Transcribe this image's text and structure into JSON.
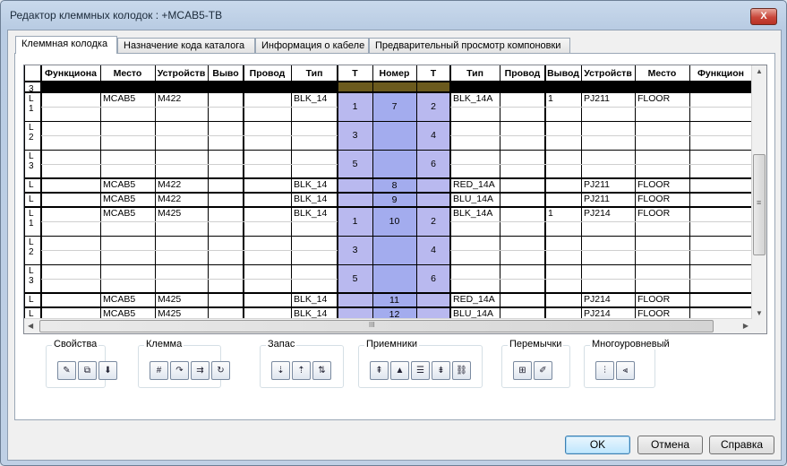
{
  "window": {
    "title": "Редактор клеммных колодок : +MCAB5-TB",
    "close_glyph": "X"
  },
  "tabs": [
    {
      "label": "Клеммная колодка",
      "active": true
    },
    {
      "label": "Назначение кода каталога",
      "active": false
    },
    {
      "label": "Информация о кабеле",
      "active": false
    },
    {
      "label": "Предварительный просмотр компоновки",
      "active": false
    }
  ],
  "grid": {
    "headers": [
      "",
      "Функциона",
      "Место",
      "Устройств",
      "Выво",
      "Провод",
      "Тип",
      "T",
      "Номер",
      "T",
      "Тип",
      "Провод",
      "Вывод",
      "Устройств",
      "Место",
      "Функцион"
    ],
    "rows": [
      {
        "id": "3",
        "cells": [
          "",
          "",
          "",
          "",
          "",
          "",
          "",
          "",
          "",
          "",
          "",
          "",
          "",
          "",
          ""
        ]
      },
      {
        "id": "L 1",
        "cells": [
          "",
          "MCAB5",
          "M422",
          "",
          "",
          "BLK_14",
          "1",
          "7",
          "2",
          "BLK_14A",
          "",
          "1",
          "PJ211",
          "FLOOR",
          ""
        ]
      },
      {
        "id": "L 2",
        "cells": [
          "",
          "",
          "",
          "",
          "",
          "",
          "3",
          "",
          "4",
          "",
          "",
          "",
          "",
          "",
          ""
        ]
      },
      {
        "id": "L 3",
        "cells": [
          "",
          "",
          "",
          "",
          "",
          "",
          "5",
          "",
          "6",
          "",
          "",
          "",
          "",
          "",
          ""
        ]
      },
      {
        "id": "L",
        "cells": [
          "",
          "MCAB5",
          "M422",
          "",
          "",
          "BLK_14",
          "",
          "8",
          "",
          "RED_14A",
          "",
          "",
          "PJ211",
          "FLOOR",
          ""
        ]
      },
      {
        "id": "L",
        "cells": [
          "",
          "MCAB5",
          "M422",
          "",
          "",
          "BLK_14",
          "",
          "9",
          "",
          "BLU_14A",
          "",
          "",
          "PJ211",
          "FLOOR",
          ""
        ]
      },
      {
        "id": "L 1",
        "cells": [
          "",
          "MCAB5",
          "M425",
          "",
          "",
          "BLK_14",
          "1",
          "10",
          "2",
          "BLK_14A",
          "",
          "1",
          "PJ214",
          "FLOOR",
          ""
        ]
      },
      {
        "id": "L 2",
        "cells": [
          "",
          "",
          "",
          "",
          "",
          "",
          "3",
          "",
          "4",
          "",
          "",
          "",
          "",
          "",
          ""
        ]
      },
      {
        "id": "L 3",
        "cells": [
          "",
          "",
          "",
          "",
          "",
          "",
          "5",
          "",
          "6",
          "",
          "",
          "",
          "",
          "",
          ""
        ]
      },
      {
        "id": "L",
        "cells": [
          "",
          "MCAB5",
          "M425",
          "",
          "",
          "BLK_14",
          "",
          "11",
          "",
          "RED_14A",
          "",
          "",
          "PJ214",
          "FLOOR",
          ""
        ]
      },
      {
        "id": "L",
        "cells": [
          "",
          "MCAB5",
          "M425",
          "",
          "",
          "BLK_14",
          "",
          "12",
          "",
          "BLU_14A",
          "",
          "",
          "PJ214",
          "FLOOR",
          ""
        ]
      }
    ],
    "colors": {
      "terminal_fill": "#b9b9ef",
      "terminal_number_fill": "#a3acee",
      "header_band": "#6b5a1d",
      "grid_line": "#000000"
    },
    "vscroll_glyph": "≡",
    "hscroll_glyph": "III"
  },
  "toolbar_groups": [
    {
      "label": "Свойства",
      "buttons": [
        {
          "icon": "edit-properties-icon",
          "glyph": "✎"
        },
        {
          "icon": "copy-properties-icon",
          "glyph": "⧉"
        },
        {
          "icon": "paste-properties-icon",
          "glyph": "⬇"
        }
      ]
    },
    {
      "label": "Клемма",
      "buttons": [
        {
          "icon": "terminal-edit-icon",
          "glyph": "#"
        },
        {
          "icon": "terminal-rotate-icon",
          "glyph": "↷"
        },
        {
          "icon": "terminal-insert-icon",
          "glyph": "⇉"
        },
        {
          "icon": "terminal-flip-icon",
          "glyph": "↻"
        }
      ]
    },
    {
      "label": "Запас",
      "buttons": [
        {
          "icon": "spare-insert-icon",
          "glyph": "⇣"
        },
        {
          "icon": "spare-delete-icon",
          "glyph": "⇡"
        },
        {
          "icon": "spare-move-icon",
          "glyph": "⇅"
        }
      ]
    },
    {
      "label": "Приемники",
      "buttons": [
        {
          "icon": "receiver-up-icon",
          "glyph": "⇞"
        },
        {
          "icon": "receiver-sort-icon",
          "glyph": "▲"
        },
        {
          "icon": "receiver-list-icon",
          "glyph": "☰"
        },
        {
          "icon": "receiver-move-icon",
          "glyph": "⇟"
        },
        {
          "icon": "receiver-link-icon",
          "glyph": "⛓"
        }
      ]
    },
    {
      "label": "Перемычки",
      "buttons": [
        {
          "icon": "jumper-add-icon",
          "glyph": "⊞"
        },
        {
          "icon": "jumper-edit-icon",
          "glyph": "✐"
        }
      ]
    },
    {
      "label": "Многоуровневый",
      "buttons": [
        {
          "icon": "multilevel-icon",
          "glyph": "⫶"
        },
        {
          "icon": "multilevel-edit-icon",
          "glyph": "⫷"
        }
      ]
    }
  ],
  "buttons": {
    "ok": "OK",
    "cancel": "Отмена",
    "help": "Справка"
  }
}
